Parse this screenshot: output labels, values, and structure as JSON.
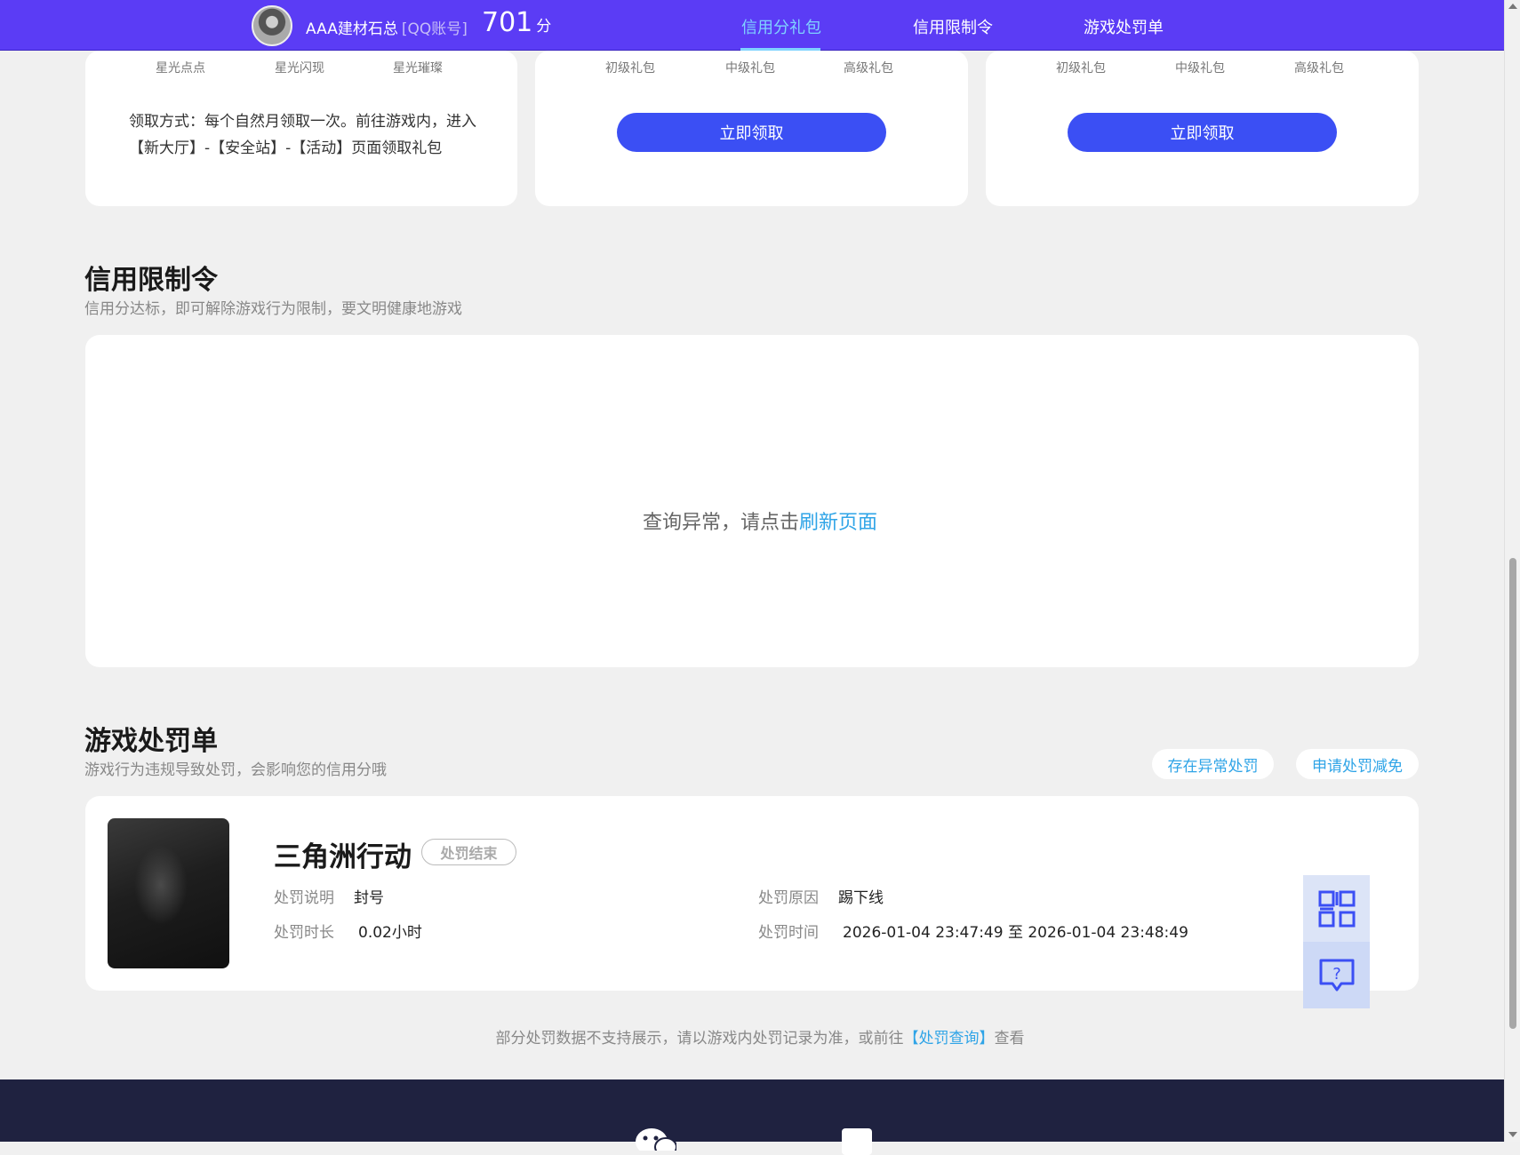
{
  "header": {
    "username": "AAA建材石总",
    "account_type": "[QQ账号]",
    "score": "701",
    "score_unit": "分",
    "tabs": [
      {
        "label": "信用分礼包",
        "active": true
      },
      {
        "label": "信用限制令",
        "active": false
      },
      {
        "label": "游戏处罚单",
        "active": false
      }
    ]
  },
  "gift_cards": [
    {
      "levels": [
        "星光点点",
        "星光闪现",
        "星光璀璨"
      ],
      "claim_method": "领取方式：每个自然月领取一次。前往游戏内，进入【新大厅】-【安全站】-【活动】页面领取礼包"
    },
    {
      "levels": [
        "初级礼包",
        "中级礼包",
        "高级礼包"
      ],
      "button": "立即领取"
    },
    {
      "levels": [
        "初级礼包",
        "中级礼包",
        "高级礼包"
      ],
      "button": "立即领取"
    }
  ],
  "restriction": {
    "title": "信用限制令",
    "subtitle": "信用分达标，即可解除游戏行为限制，要文明健康地游戏",
    "error_prefix": "查询异常，请点击",
    "error_link": "刷新页面"
  },
  "punishment": {
    "title": "游戏处罚单",
    "subtitle": "游戏行为违规导致处罚，会影响您的信用分哦",
    "actions": [
      "存在异常处罚",
      "申请处罚减免"
    ],
    "record": {
      "game": "三角洲行动",
      "status": "处罚结束",
      "desc_label": "处罚说明",
      "desc_value": "封号",
      "duration_label": "处罚时长",
      "duration_value": "0.02小时",
      "reason_label": "处罚原因",
      "reason_value": "踢下线",
      "time_label": "处罚时间",
      "time_value": "2026-01-04 23:47:49 至 2026-01-04 23:48:49"
    },
    "footer_prefix": "部分处罚数据不支持展示，请以游戏内处罚记录为准，或前往",
    "footer_link": "【处罚查询】",
    "footer_suffix": "查看"
  },
  "side_tools": [
    "qrcode-icon",
    "help-chat-icon"
  ],
  "colors": {
    "header_bg": "#5b3cf5",
    "accent_button": "#3b4ff4",
    "link": "#2fa4e7",
    "active_tab": "#7fd3ff",
    "footer_bg": "#1f2240"
  }
}
